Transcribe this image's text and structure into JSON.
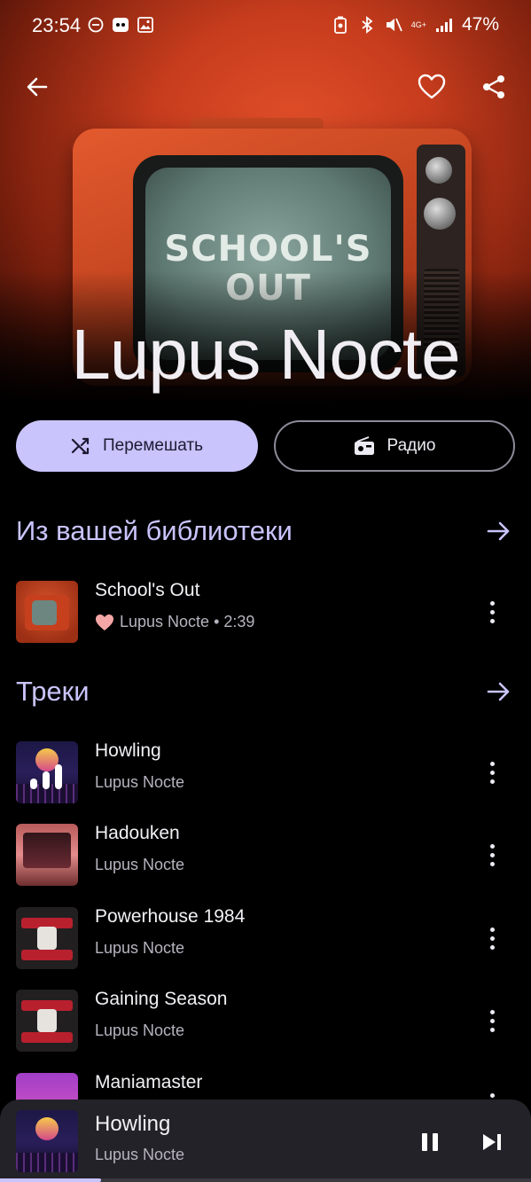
{
  "status_bar": {
    "time": "23:54",
    "battery": "47%",
    "network": "4G+"
  },
  "artist": {
    "name": "Lupus Nocte",
    "cover_text": "SCHOOL'S OUT"
  },
  "actions": {
    "shuffle_label": "Перемешать",
    "radio_label": "Радио"
  },
  "library_section": {
    "title": "Из вашей библиотеки",
    "items": [
      {
        "title": "School's Out",
        "artist": "Lupus Nocte",
        "duration": "2:39",
        "liked": true,
        "meta": "Lupus Nocte • 2:39"
      }
    ]
  },
  "tracks_section": {
    "title": "Треки",
    "items": [
      {
        "title": "Howling",
        "artist": "Lupus Nocte",
        "playing": true
      },
      {
        "title": "Hadouken",
        "artist": "Lupus Nocte"
      },
      {
        "title": "Powerhouse 1984",
        "artist": "Lupus Nocte"
      },
      {
        "title": "Gaining Season",
        "artist": "Lupus Nocte"
      },
      {
        "title": "Maniamaster",
        "artist": ""
      }
    ]
  },
  "now_playing": {
    "title": "Howling",
    "artist": "Lupus Nocte",
    "progress_fraction": 0.19
  },
  "colors": {
    "accent": "#c9c4fb",
    "background": "#000000",
    "mini_player_bg": "#232228",
    "heart": "#f4a6a6"
  }
}
